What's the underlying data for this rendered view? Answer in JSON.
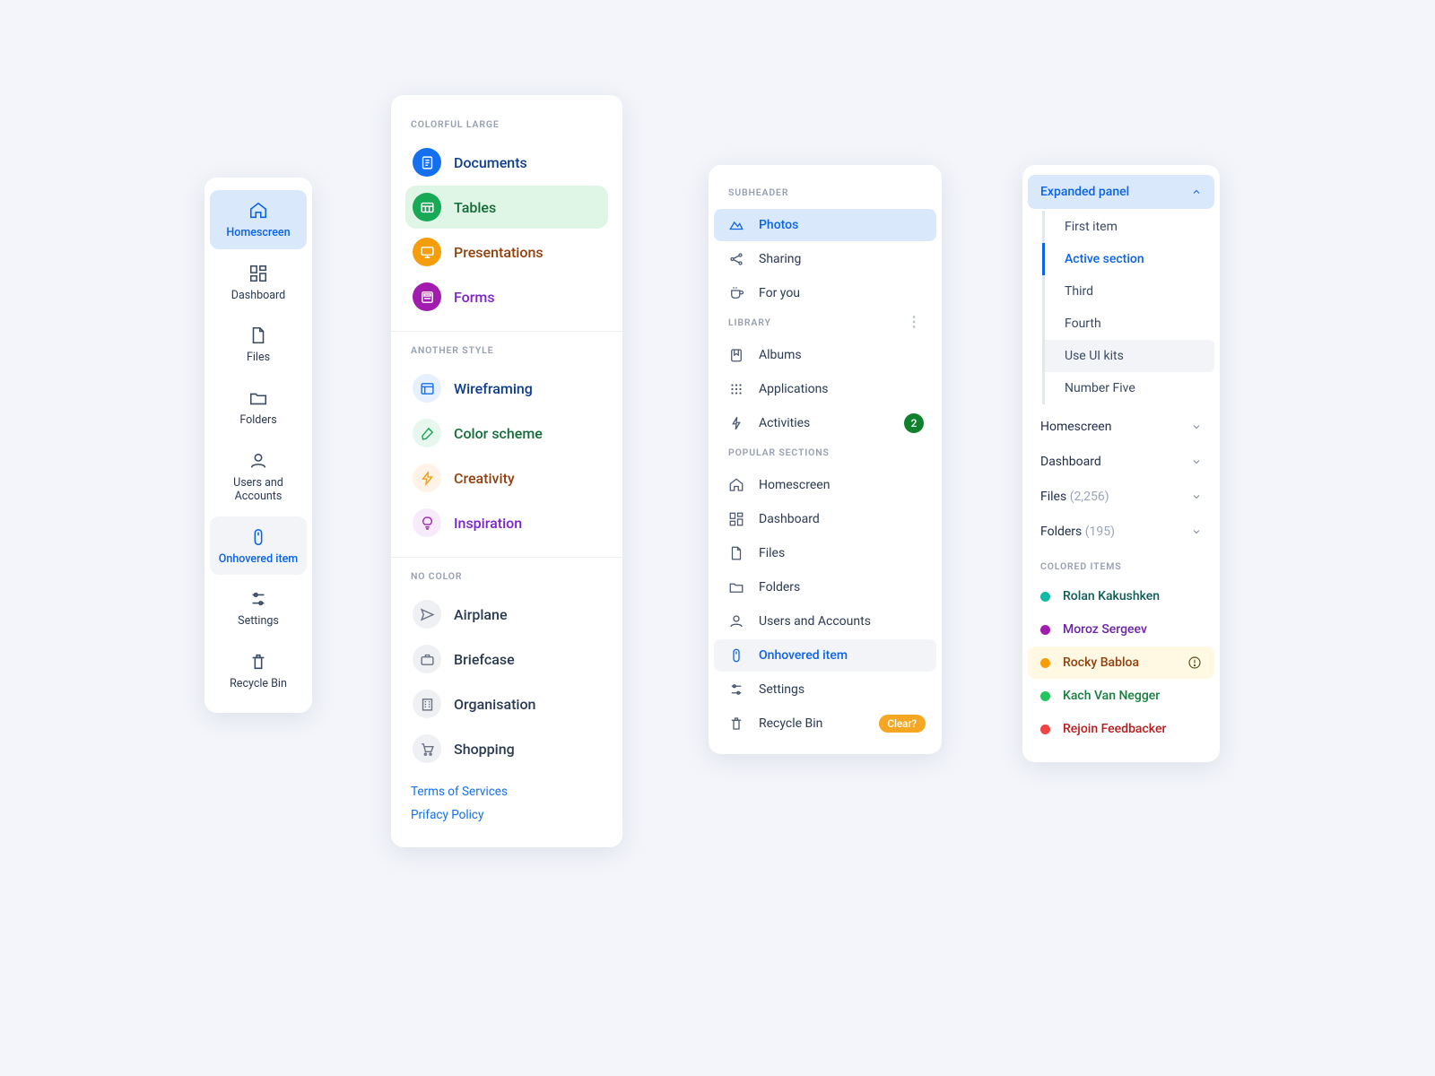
{
  "panel1": {
    "items": [
      {
        "label": "Homescreen",
        "icon": "home"
      },
      {
        "label": "Dashboard",
        "icon": "dashboard"
      },
      {
        "label": "Files",
        "icon": "file"
      },
      {
        "label": "Folders",
        "icon": "folder"
      },
      {
        "label": "Users and Accounts",
        "icon": "user"
      },
      {
        "label": "Onhovered item",
        "icon": "mouse"
      },
      {
        "label": "Settings",
        "icon": "sliders"
      },
      {
        "label": "Recycle Bin",
        "icon": "trash"
      }
    ]
  },
  "panel2": {
    "headers": {
      "colorful": "COLORFUL LARGE",
      "another": "ANOTHER STYLE",
      "nocolor": "NO COLOR"
    },
    "colorful": [
      {
        "label": "Documents",
        "bg": "#1570EF",
        "text": "#0F3E8E",
        "icon": "doc"
      },
      {
        "label": "Tables",
        "bg": "#18A957",
        "text": "#136C37",
        "icon": "table",
        "selectedBg": "#DFF5E5"
      },
      {
        "label": "Presentations",
        "bg": "#F59E0B",
        "text": "#92400E",
        "icon": "present"
      },
      {
        "label": "Forms",
        "bg": "#A21CAF",
        "text": "#7E22CE",
        "icon": "form"
      }
    ],
    "another": [
      {
        "label": "Wireframing",
        "bg": "#E7F0FE",
        "fg": "#1570EF",
        "text": "#0F3E8E",
        "icon": "wireframe"
      },
      {
        "label": "Color scheme",
        "bg": "#E7F7EE",
        "fg": "#18A957",
        "text": "#136C37",
        "icon": "dropper"
      },
      {
        "label": "Creativity",
        "bg": "#FEF3E6",
        "fg": "#F59E0B",
        "text": "#92400E",
        "icon": "bolt2"
      },
      {
        "label": "Inspiration",
        "bg": "#F7EBFB",
        "fg": "#A21CAF",
        "text": "#7E22CE",
        "icon": "bulb"
      }
    ],
    "nocolor": [
      {
        "label": "Airplane",
        "icon": "plane"
      },
      {
        "label": "Briefcase",
        "icon": "briefcase"
      },
      {
        "label": "Organisation",
        "icon": "building"
      },
      {
        "label": "Shopping",
        "icon": "cart"
      }
    ],
    "links": {
      "terms": "Terms of Services",
      "privacy": "Prifacy Policy"
    }
  },
  "panel3": {
    "headers": {
      "sub": "SUBHEADER",
      "lib": "LIBRARY",
      "pop": "POPULAR SECTIONS"
    },
    "sub": [
      {
        "label": "Photos",
        "icon": "mountain"
      },
      {
        "label": "Sharing",
        "icon": "share"
      },
      {
        "label": "For you",
        "icon": "cup"
      }
    ],
    "lib": [
      {
        "label": "Albums",
        "icon": "bookmark"
      },
      {
        "label": "Applications",
        "icon": "grid"
      },
      {
        "label": "Activities",
        "icon": "bolt",
        "badge": "2"
      }
    ],
    "pop": [
      {
        "label": "Homescreen",
        "icon": "home"
      },
      {
        "label": "Dashboard",
        "icon": "dashboard"
      },
      {
        "label": "Files",
        "icon": "file"
      },
      {
        "label": "Folders",
        "icon": "folder"
      },
      {
        "label": "Users and Accounts",
        "icon": "user"
      },
      {
        "label": "Onhovered item",
        "icon": "mouse"
      },
      {
        "label": "Settings",
        "icon": "sliders"
      },
      {
        "label": "Recycle Bin",
        "icon": "trash",
        "pill": "Clear?"
      }
    ]
  },
  "panel4": {
    "expanded": {
      "label": "Expanded panel"
    },
    "sub": [
      "First item",
      "Active section",
      "Third",
      "Fourth",
      "Use UI kits",
      "Number Five"
    ],
    "collapsed": [
      {
        "label": "Homescreen",
        "count": ""
      },
      {
        "label": "Dashboard",
        "count": ""
      },
      {
        "label": "Files",
        "count": "(2,256)"
      },
      {
        "label": "Folders",
        "count": "(195)"
      }
    ],
    "coloredHeader": "COLORED ITEMS",
    "colored": [
      {
        "label": "Rolan Kakushken",
        "dot": "#14B8A6",
        "text": "#0F5D56"
      },
      {
        "label": "Moroz Sergeev",
        "dot": "#A21CAF",
        "text": "#6B21A8"
      },
      {
        "label": "Rocky Babloa",
        "dot": "#F59E0B",
        "text": "#92400E",
        "warn": true
      },
      {
        "label": "Kach Van Negger",
        "dot": "#22C55E",
        "text": "#15803D"
      },
      {
        "label": "Rejoin Feedbacker",
        "dot": "#EF4444",
        "text": "#B91C1C"
      }
    ]
  }
}
